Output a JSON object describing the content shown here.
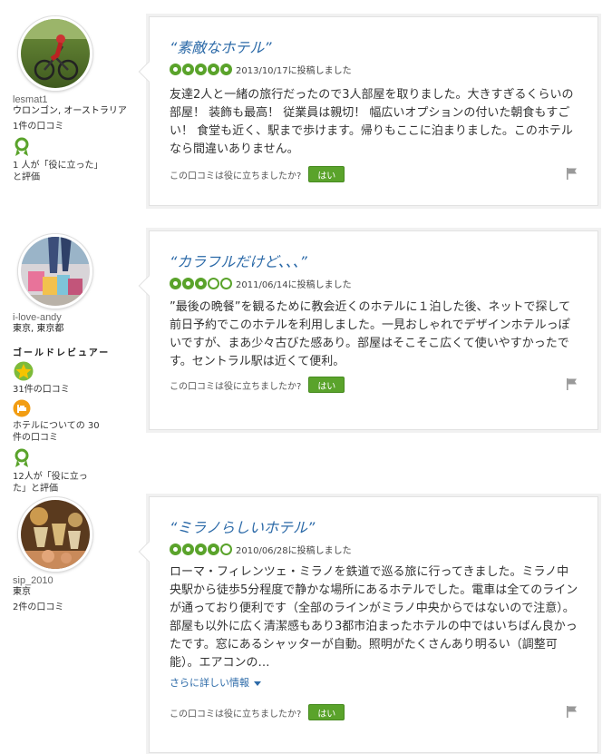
{
  "reviews": [
    {
      "username": "lesmat1",
      "location": "ウロンゴン, オーストラリア",
      "review_count": "1件の口コミ",
      "helpful_votes": "1 人が「役に立った」と評価",
      "title": "“素敵なホテル”",
      "rating": 5,
      "date": "2013/10/17に投稿しました",
      "text": "友達2人と一緒の旅行だったので3人部屋を取りました。大きすぎるくらいの部屋！ 装飾も最高！ 従業員は親切！ 幅広いオプションの付いた朝食もすごい！ 食堂も近く、駅まで歩けます。帰りもここに泊まりました。このホテルなら間違いありません。",
      "helpful_question": "この口コミは役に立ちましたか?",
      "yes_label": "はい"
    },
    {
      "username": "i-love-andy",
      "location": "東京, 東京都",
      "badge": "ゴールドレビュアー",
      "review_count": "31件の口コミ",
      "hotel_reviews": "ホテルについての 30 件の口コミ",
      "helpful_votes": "12人が「役に立った」と評価",
      "title": "“カラフルだけど、、、”",
      "rating": 3,
      "date": "2011/06/14に投稿しました",
      "text": "”最後の晩餐”を観るために教会近くのホテルに１泊した後、ネットで探して前日予約でこのホテルを利用しました。一見おしゃれでデザインホテルっぽいですが、まあ少々古びた感あり。部屋はそこそこ広くて使いやすかったです。セントラル駅は近くて便利。",
      "helpful_question": "この口コミは役に立ちましたか?",
      "yes_label": "はい"
    },
    {
      "username": "sip_2010",
      "location": "東京",
      "review_count": "2件の口コミ",
      "title": "“ミラノらしいホテル”",
      "rating": 4,
      "date": "2010/06/28に投稿しました",
      "text": "ローマ・フィレンツェ・ミラノを鉄道で巡る旅に行ってきました。ミラノ中央駅から徒歩5分程度で静かな場所にあるホテルでした。電車は全てのラインが通っており便利です（全部のラインがミラノ中央からではないので注意）。部屋も以外に広く清潔感もあり3都市泊まったホテルの中ではいちばん良かったです。窓にあるシャッターが自動。照明がたくさんあり明るい（調整可能）。エアコンの…",
      "more_label": "さらに詳しい情報",
      "helpful_question": "この口コミは役に立ちましたか?",
      "yes_label": "はい"
    }
  ],
  "colors": {
    "accent_green": "#5aa32b",
    "title_blue": "#2c6aa8"
  }
}
